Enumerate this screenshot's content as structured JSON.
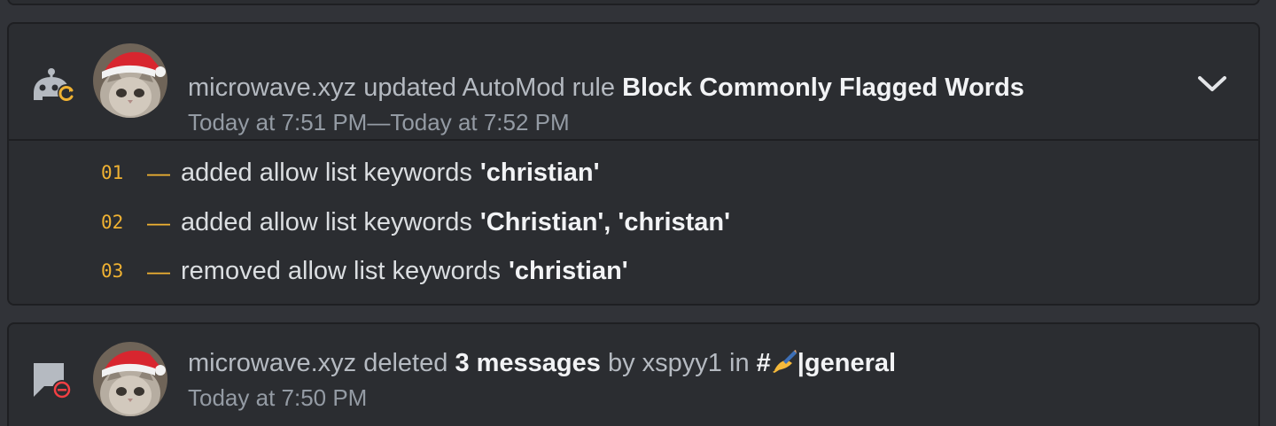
{
  "entries": [
    {
      "actor": "microwave.xyz",
      "action_text": "updated AutoMod rule",
      "target": "Block Commonly Flagged Words",
      "timestamp": "Today at 7:51 PM—Today at 7:52 PM",
      "icon": "automod-update-icon",
      "expanded": true,
      "changes": [
        {
          "number": "01",
          "dash": "—",
          "text": "added allow list keywords",
          "value": "'christian'"
        },
        {
          "number": "02",
          "dash": "—",
          "text": "added allow list keywords",
          "value": "'Christian', 'christan'"
        },
        {
          "number": "03",
          "dash": "—",
          "text": "removed allow list keywords",
          "value": "'christian'"
        }
      ]
    },
    {
      "actor": "microwave.xyz",
      "action_text": "deleted",
      "count_text": "3 messages",
      "by_text": "by",
      "author": "xspyy1",
      "in_text": "in",
      "channel_hash": "#",
      "channel_name": "|general",
      "timestamp": "Today at 7:50 PM",
      "icon": "message-delete-icon"
    }
  ],
  "colors": {
    "background": "#313338",
    "card": "#2b2d31",
    "accent_number": "#f0b232",
    "delete_red": "#f23f43",
    "icon_gray": "#b5bac1"
  }
}
